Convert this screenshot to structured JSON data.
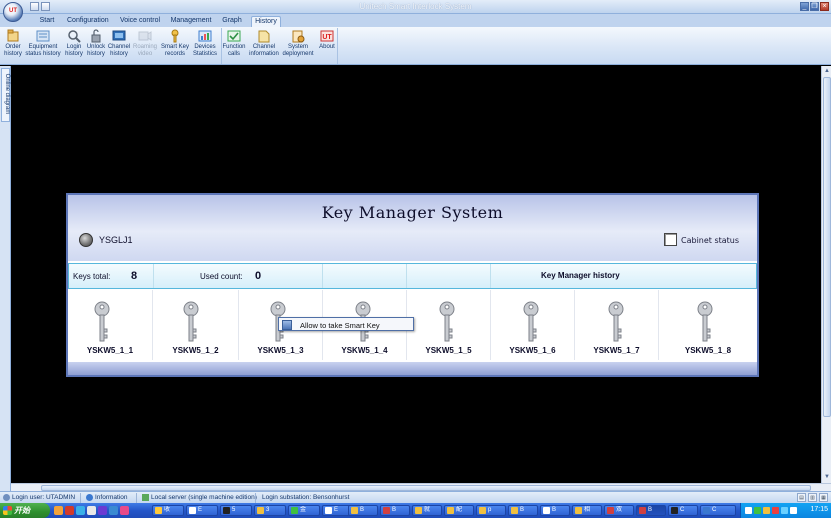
{
  "window": {
    "title": "Unitech Smart Interlock System",
    "logo_text": "UT",
    "controls": {
      "minimize": "_",
      "restore": "❐",
      "close": "×"
    }
  },
  "ribbon": {
    "tabs": [
      {
        "label": "Start"
      },
      {
        "label": "Configuration"
      },
      {
        "label": "Voice control"
      },
      {
        "label": "Management"
      },
      {
        "label": "Graph"
      },
      {
        "label": "History"
      }
    ],
    "active_tab": "History",
    "buttons": [
      {
        "label": "Order\nhistory",
        "icon": "order-history-icon",
        "color": "#d8a34a"
      },
      {
        "label": "Equipment\nstatus history",
        "icon": "equipment-status-history-icon",
        "color": "#5e8fc7"
      },
      {
        "label": "Login\nhistory",
        "icon": "login-history-icon",
        "color": "#6c6c7a"
      },
      {
        "label": "Unlock\nhistory",
        "icon": "unlock-history-icon",
        "color": "#7d7d8c"
      },
      {
        "label": "Channel\nhistory",
        "icon": "channel-history-icon",
        "color": "#4f8fd1"
      },
      {
        "label": "Roaming\nvideo",
        "icon": "roaming-video-icon",
        "color": "#9aa8bb",
        "disabled": true
      },
      {
        "label": "Smart Key\nrecords",
        "icon": "smart-key-records-icon",
        "color": "#e0a33a"
      },
      {
        "label": "Devices\nStatistics",
        "icon": "devices-statistics-icon",
        "color": "#3f7fd1"
      },
      {
        "label": "Function\ncalls",
        "icon": "function-calls-icon",
        "color": "#3aa852"
      },
      {
        "label": "Channel\ninformation",
        "icon": "channel-information-icon",
        "color": "#e0b84a"
      },
      {
        "label": "System\ndeployment",
        "icon": "system-deployment-icon",
        "color": "#d8a34a"
      },
      {
        "label": "About",
        "icon": "about-icon",
        "color": "#d83a3a"
      }
    ]
  },
  "side_panel": {
    "tab_label": "Online diagram"
  },
  "key_manager": {
    "title": "Key Manager System",
    "station": "YSGLJ1",
    "cabinet_status_label": "Cabinet status",
    "keys_total_label": "Keys total:",
    "keys_total": "8",
    "used_count_label": "Used count:",
    "used_count": "0",
    "history_link": "Key Manager history",
    "keys": [
      {
        "name": "YSKW5_1_1"
      },
      {
        "name": "YSKW5_1_2"
      },
      {
        "name": "YSKW5_1_3"
      },
      {
        "name": "YSKW5_1_4"
      },
      {
        "name": "YSKW5_1_5"
      },
      {
        "name": "YSKW5_1_6"
      },
      {
        "name": "YSKW5_1_7"
      },
      {
        "name": "YSKW5_1_8"
      }
    ]
  },
  "context_menu": {
    "item": "Allow to take Smart Key"
  },
  "status_bar": {
    "login_user": "Login user: UTADMIN",
    "information": "Information",
    "server": "Local server (single machine edition)",
    "substation": "Login substation: Bensonhurst"
  },
  "taskbar": {
    "start_label": "开始",
    "clock": "17:15",
    "tasks": [
      {
        "label": "收"
      },
      {
        "label": "E"
      },
      {
        "label": "5"
      },
      {
        "label": "3"
      },
      {
        "label": "金"
      },
      {
        "label": "E"
      },
      {
        "label": "B"
      },
      {
        "label": "B"
      },
      {
        "label": "就"
      },
      {
        "label": "配"
      },
      {
        "label": "p"
      },
      {
        "label": "B"
      },
      {
        "label": "B"
      },
      {
        "label": "相"
      },
      {
        "label": "双"
      },
      {
        "label": "B"
      },
      {
        "label": "C"
      },
      {
        "label": "C"
      }
    ]
  }
}
